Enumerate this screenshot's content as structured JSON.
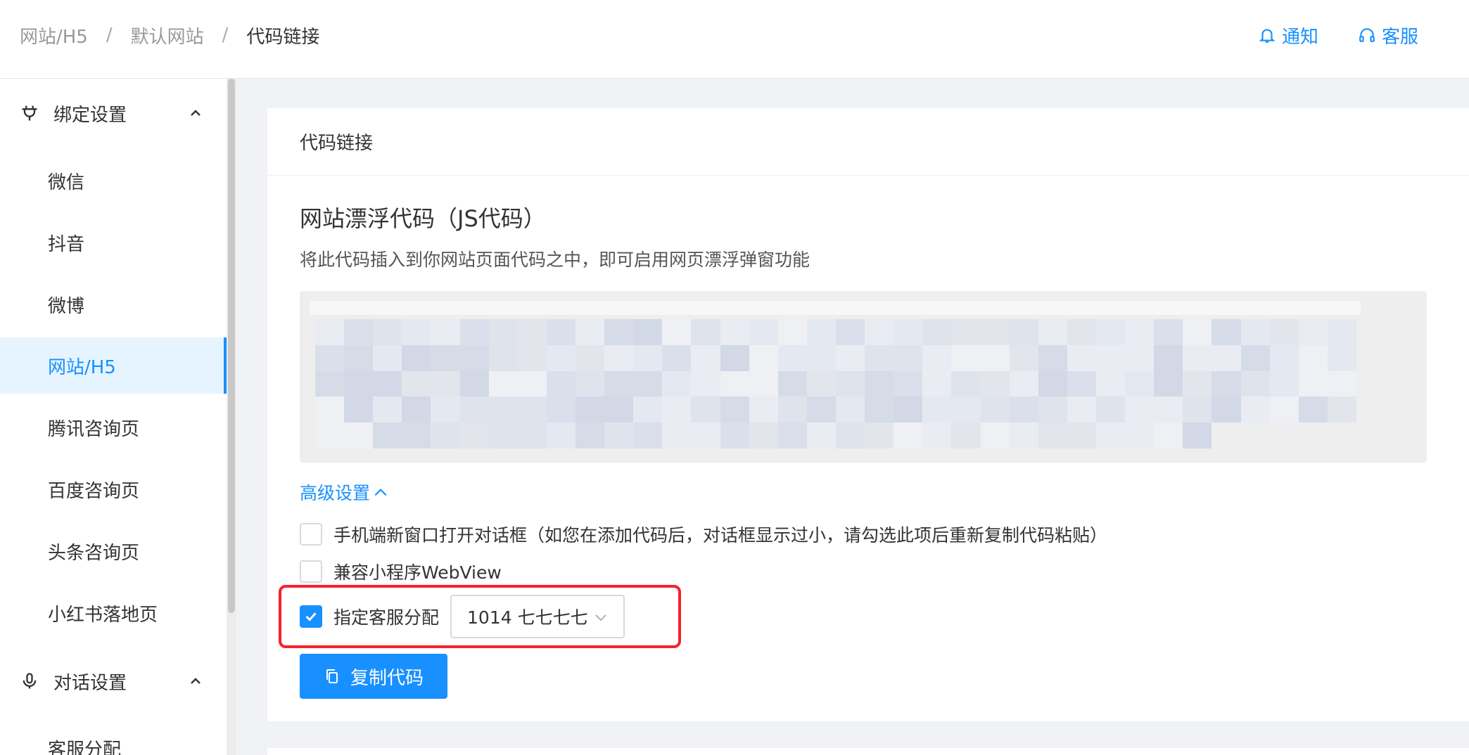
{
  "breadcrumb": [
    "网站/H5",
    "默认网站",
    "代码链接"
  ],
  "breadcrumb_separator": "/",
  "header": {
    "notify": "通知",
    "service": "客服",
    "accent": "#1890ff"
  },
  "sidebar": {
    "groups": [
      {
        "label": "绑定设置",
        "icon": "plug-icon",
        "expanded": true
      },
      {
        "label": "对话设置",
        "icon": "microphone-icon",
        "expanded": true
      }
    ],
    "items": [
      "微信",
      "抖音",
      "微博",
      "网站/H5",
      "腾讯咨询页",
      "百度咨询页",
      "头条咨询页",
      "小红书落地页",
      "客服分配"
    ],
    "active": "网站/H5"
  },
  "card": {
    "header": "代码链接",
    "title": "网站漂浮代码（JS代码）",
    "description": "将此代码插入到你网站页面代码之中，即可启用网页漂浮弹窗功能",
    "advanced_label": "高级设置",
    "options": [
      {
        "label": "手机端新窗口打开对话框（如您在添加代码后，对话框显示过小，请勾选此项后重新复制代码粘贴）",
        "checked": false
      },
      {
        "label": "兼容小程序WebView",
        "checked": false
      },
      {
        "label": "指定客服分配",
        "checked": true
      }
    ],
    "agent_select_value": "1014 七七七七",
    "copy_button": "复制代码"
  },
  "colors": {
    "primary": "#1890ff",
    "highlight": "#f5222d",
    "active_bg": "#e6f4ff"
  }
}
